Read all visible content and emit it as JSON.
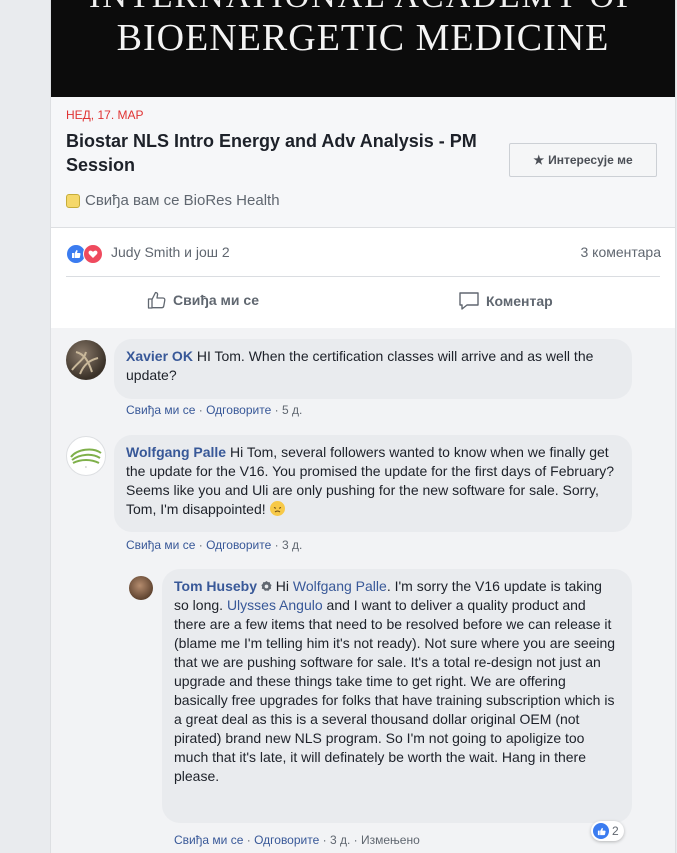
{
  "banner": {
    "line_top": "INTERNATIONAL ACADEMY OF",
    "line_main": "BIOENERGETIC MEDICINE"
  },
  "event": {
    "date": "НЕД, 17. МАР",
    "title": "Biostar NLS Intro Energy and Adv Analysis - PM Session",
    "interested_label": "Интересује ме",
    "liked_by": "Свиђа вам се BioRes Health"
  },
  "reactions": {
    "names": "Judy Smith и још 2",
    "comment_count": "3 коментара"
  },
  "actions": {
    "like": "Свиђа ми се",
    "comment": "Коментар"
  },
  "comments": [
    {
      "author": "Xavier OK",
      "text": "HI Tom. When the certification classes will arrive and as well the update?",
      "like": "Свиђа ми се",
      "reply": "Одговорите",
      "time": "5 д."
    },
    {
      "author": "Wolfgang Palle",
      "text": "Hi Tom, several followers wanted to know when we finally get the update for the V16. You promised the update for the first days of February? Seems like you and Uli are only pushing for the new software for sale. Sorry, Tom, I'm disappointed!",
      "like": "Свиђа ми се",
      "reply": "Одговорите",
      "time": "3 д."
    },
    {
      "author": "Tom Huseby",
      "text_hi": "Hi",
      "mention1": "Wolfgang Palle",
      "text_a": ". I'm sorry the V16 update is taking so long.",
      "mention2": "Ulysses Angulo",
      "text_b": "and I want to deliver a quality product and there are a few items that need to be resolved before we can release it (blame me I'm telling him it's not ready). Not sure where you are seeing that we are pushing software for sale. It's a total re-design not just an upgrade and these things take time to get right. We are offering basically free upgrades for folks that have training subscription which is a great deal as this is a several thousand dollar original OEM (not pirated) brand new NLS program. So I'm not going to apoligize too much that it's late, it will definately be worth the wait. Hang in there please.",
      "like": "Свиђа ми се",
      "reply": "Одговорите",
      "time": "3 д.",
      "edited": "Измењено",
      "reaction_count": "2"
    }
  ],
  "colors": {
    "accent": "#385898",
    "date_red": "#e03333",
    "like_blue": "#3b7cf0",
    "love_red": "#ef4a5e"
  }
}
